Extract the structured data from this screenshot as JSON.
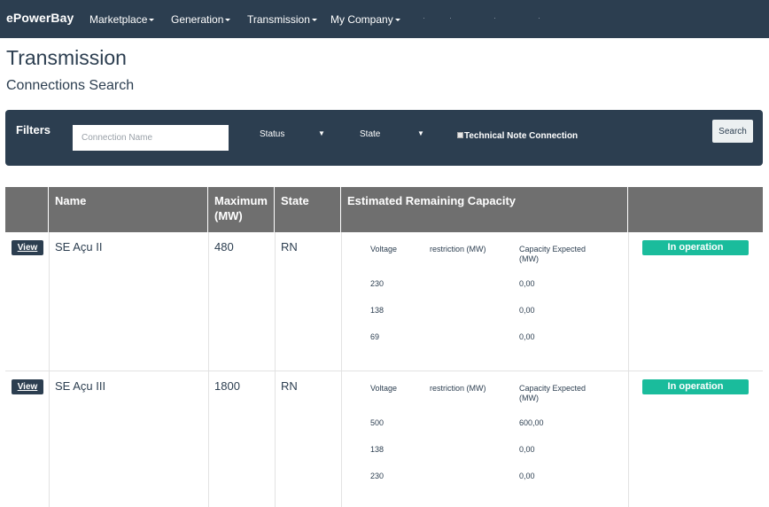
{
  "navbar": {
    "brand": "ePowerBay",
    "items": [
      "Marketplace",
      "Generation",
      "Transmission",
      "My Company"
    ]
  },
  "page": {
    "title": "Transmission",
    "subtitle": "Connections Search"
  },
  "filters": {
    "label": "Filters",
    "connection_placeholder": "Connection Name",
    "status_label": "Status",
    "state_label": "State",
    "arrow_glyph": "▼",
    "technical_note_label": "Technical Note Connection",
    "search_label": "Search"
  },
  "table": {
    "headers": {
      "name": "Name",
      "maximum": "Maximum (MW)",
      "state": "State",
      "capacity": "Estimated Remaining Capacity"
    },
    "sub_headers": {
      "voltage": "Voltage",
      "restriction": "restriction (MW)",
      "expected": "Capacity Expected (MW)"
    },
    "view_label": "View",
    "rows": [
      {
        "name": "SE Açu II",
        "maximum": "480",
        "state": "RN",
        "status": "In operation",
        "capacity": [
          {
            "voltage": "230",
            "expected": "0,00"
          },
          {
            "voltage": "138",
            "expected": "0,00"
          },
          {
            "voltage": "69",
            "expected": "0,00"
          }
        ]
      },
      {
        "name": "SE Açu III",
        "maximum": "1800",
        "state": "RN",
        "status": "In operation",
        "capacity": [
          {
            "voltage": "500",
            "expected": "600,00"
          },
          {
            "voltage": "138",
            "expected": "0,00"
          },
          {
            "voltage": "230",
            "expected": "0,00"
          }
        ]
      }
    ]
  },
  "colors": {
    "navbar": "#2c3e50",
    "table_header": "#6f6f6f",
    "status_badge": "#1abc9c"
  }
}
